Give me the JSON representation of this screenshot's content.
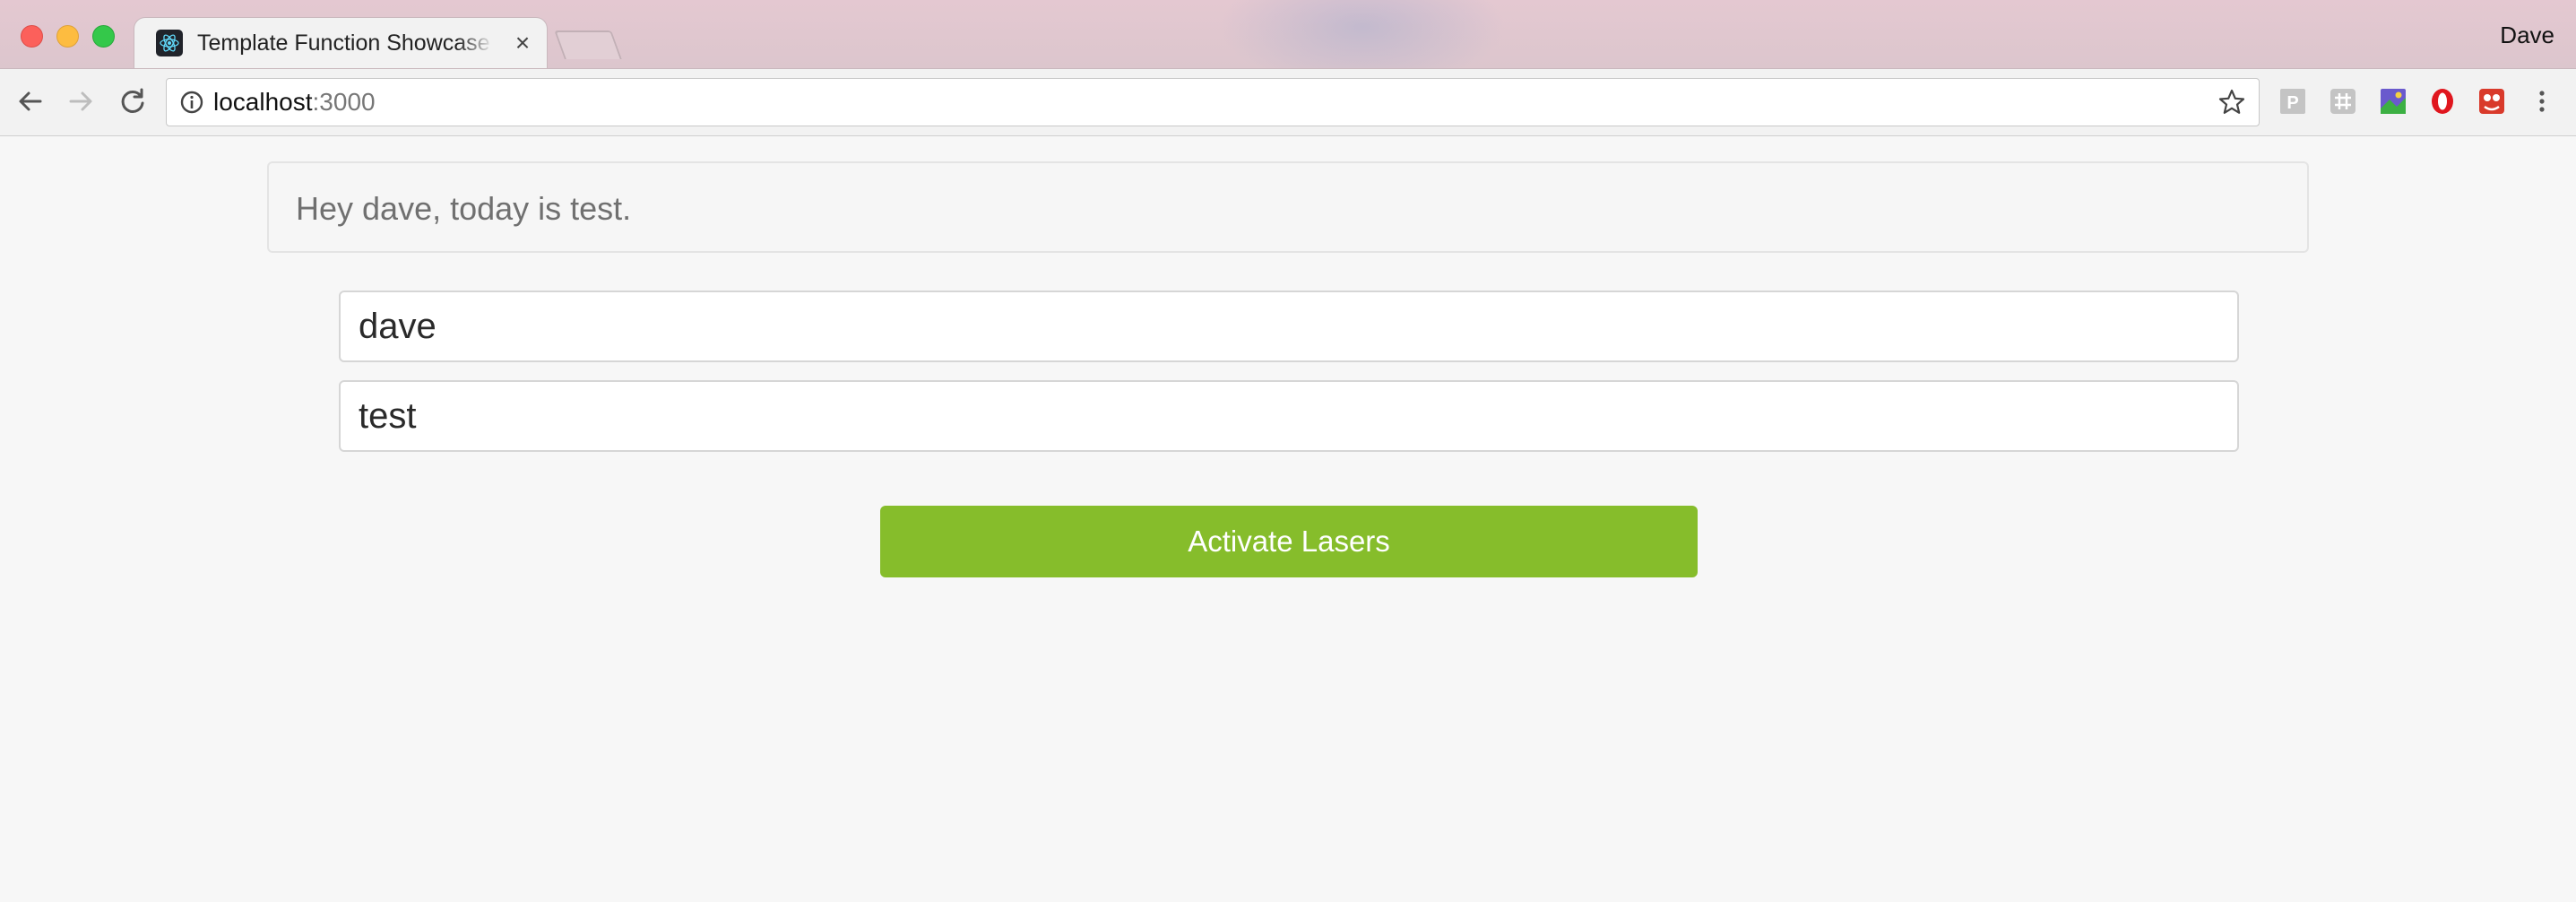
{
  "window": {
    "profile_name": "Dave"
  },
  "tabs": [
    {
      "title": "Template Function Showcase App",
      "active": true,
      "favicon": "react-logo-icon"
    }
  ],
  "toolbar": {
    "url_host": "localhost",
    "url_port": ":3000",
    "icons": [
      "back-arrow-icon",
      "forward-arrow-icon",
      "reload-icon",
      "info-icon",
      "star-icon"
    ],
    "extensions": [
      "p-extension-icon",
      "grid-extension-icon",
      "image-extension-icon",
      "opera-extension-icon",
      "red-extension-icon",
      "menu-icon"
    ]
  },
  "page": {
    "greeting": "Hey dave, today is test.",
    "name_value": "dave",
    "day_value": "test",
    "button_label": "Activate Lasers"
  },
  "colors": {
    "button": "#86bd2b",
    "page_background": "#f7f7f7",
    "titlebar": "#e4c8d1"
  }
}
